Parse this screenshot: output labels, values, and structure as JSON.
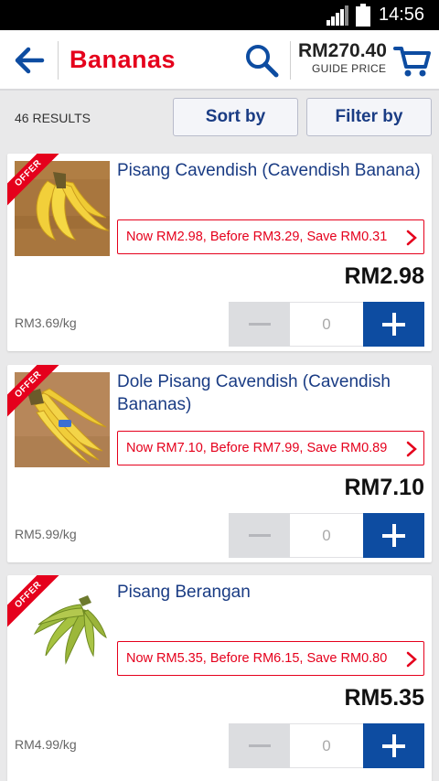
{
  "status_bar": {
    "time": "14:56"
  },
  "header": {
    "title": "Bananas",
    "guide_total": "RM270.40",
    "guide_label": "GUIDE PRICE"
  },
  "results_bar": {
    "count_label": "46 RESULTS",
    "sort_label": "Sort by",
    "filter_label": "Filter by"
  },
  "colors": {
    "brand_red": "#e5001c",
    "brand_blue": "#1a3c84",
    "button_blue": "#0d4ca1"
  },
  "products": [
    {
      "badge": "OFFER",
      "name": "Pisang Cavendish (Cavendish Banana)",
      "offer": "Now RM2.98, Before RM3.29, Save RM0.31",
      "price": "RM2.98",
      "unit_price": "RM3.69/kg",
      "quantity": "0",
      "image": "yellow-banana-bunch"
    },
    {
      "badge": "OFFER",
      "name": "Dole Pisang Cavendish (Cavendish Bananas)",
      "offer": "Now RM7.10, Before RM7.99, Save RM0.89",
      "price": "RM7.10",
      "unit_price": "RM5.99/kg",
      "quantity": "0",
      "image": "dole-banana-bunch"
    },
    {
      "badge": "OFFER",
      "name": "Pisang Berangan",
      "offer": "Now RM5.35, Before RM6.15, Save RM0.80",
      "price": "RM5.35",
      "unit_price": "RM4.99/kg",
      "quantity": "0",
      "image": "green-banana-bunch"
    }
  ]
}
